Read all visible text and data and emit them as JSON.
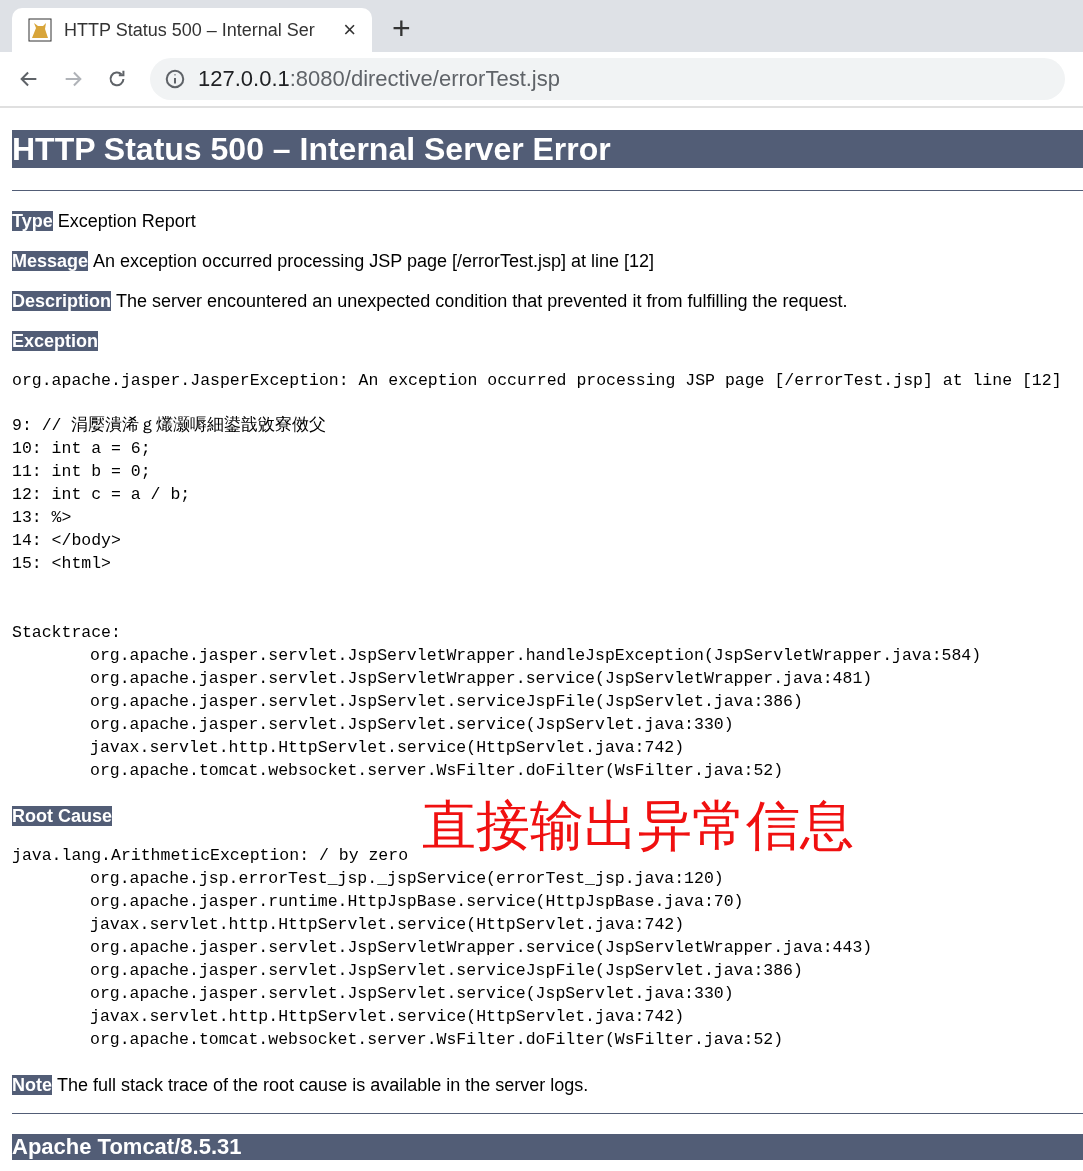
{
  "browser": {
    "tab_title": "HTTP Status 500 – Internal Ser",
    "new_tab": "+",
    "close": "×",
    "url_host": "127.0.0.1",
    "url_path": ":8080/directive/errorTest.jsp",
    "forward_disabled": true
  },
  "heading": "HTTP Status 500 – Internal Server Error",
  "fields": [
    {
      "label": "Type",
      "value": "Exception Report"
    },
    {
      "label": "Message",
      "value": "An exception occurred processing JSP page [/errorTest.jsp] at line [12]"
    },
    {
      "label": "Description",
      "value": "The server encountered an unexpected condition that prevented it from fulfilling the request."
    }
  ],
  "exception": {
    "label": "Exception",
    "message": "org.apache.jasper.JasperException: An exception occurred processing JSP page [/errorTest.jsp] at line [12]",
    "code_lines": [
      "9: // 涓嬮潰浠ｇ爜灏嗕細鍙戠敓寮傚父",
      "10: int a = 6;",
      "11: int b = 0;",
      "12: int c = a / b;",
      "13: %>",
      "14: </body>",
      "15: <html>"
    ],
    "stacktrace_label": "Stacktrace:",
    "frames": [
      "org.apache.jasper.servlet.JspServletWrapper.handleJspException(JspServletWrapper.java:584)",
      "org.apache.jasper.servlet.JspServletWrapper.service(JspServletWrapper.java:481)",
      "org.apache.jasper.servlet.JspServlet.serviceJspFile(JspServlet.java:386)",
      "org.apache.jasper.servlet.JspServlet.service(JspServlet.java:330)",
      "javax.servlet.http.HttpServlet.service(HttpServlet.java:742)",
      "org.apache.tomcat.websocket.server.WsFilter.doFilter(WsFilter.java:52)"
    ]
  },
  "root_cause": {
    "label": "Root Cause",
    "message": "java.lang.ArithmeticException: / by zero",
    "frames": [
      "org.apache.jsp.errorTest_jsp._jspService(errorTest_jsp.java:120)",
      "org.apache.jasper.runtime.HttpJspBase.service(HttpJspBase.java:70)",
      "javax.servlet.http.HttpServlet.service(HttpServlet.java:742)",
      "org.apache.jasper.servlet.JspServletWrapper.service(JspServletWrapper.java:443)",
      "org.apache.jasper.servlet.JspServlet.serviceJspFile(JspServlet.java:386)",
      "org.apache.jasper.servlet.JspServlet.service(JspServlet.java:330)",
      "javax.servlet.http.HttpServlet.service(HttpServlet.java:742)",
      "org.apache.tomcat.websocket.server.WsFilter.doFilter(WsFilter.java:52)"
    ]
  },
  "annotation": "直接输出异常信息",
  "note": {
    "label": "Note",
    "value": "The full stack trace of the root cause is available in the server logs."
  },
  "footer": "Apache Tomcat/8.5.31"
}
